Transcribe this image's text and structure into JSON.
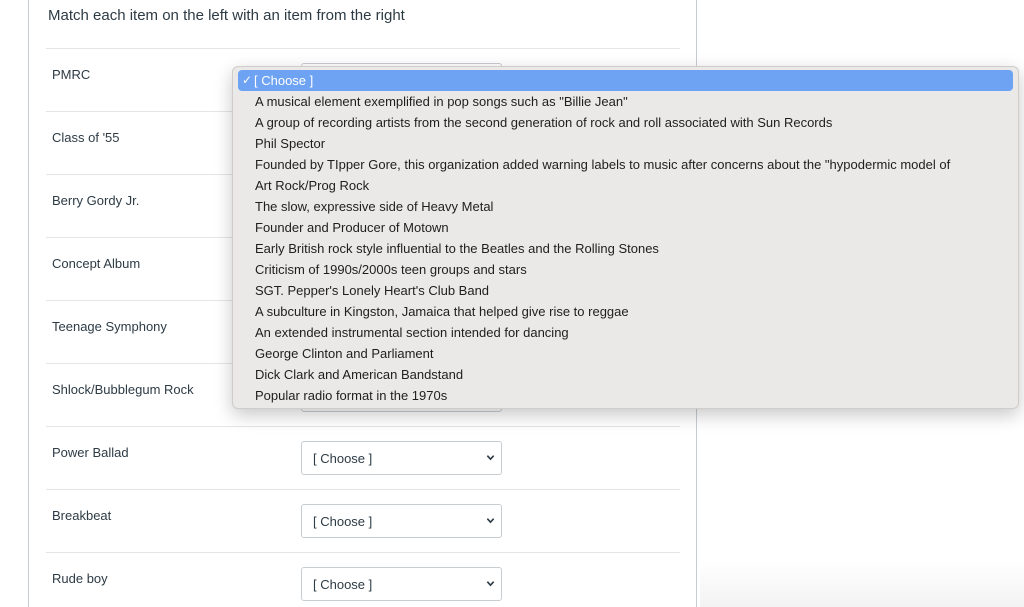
{
  "instructions": "Match each item on the left with an item from the right",
  "rows": [
    {
      "label": "PMRC",
      "value": "[ Choose ]"
    },
    {
      "label": "Class of '55",
      "value": "[ Choose ]"
    },
    {
      "label": "Berry Gordy Jr.",
      "value": "[ Choose ]"
    },
    {
      "label": "Concept Album",
      "value": "[ Choose ]"
    },
    {
      "label": "Teenage Symphony",
      "value": "[ Choose ]"
    },
    {
      "label": "Shlock/Bubblegum Rock",
      "value": "[ Choose ]"
    },
    {
      "label": "Power Ballad",
      "value": "[ Choose ]"
    },
    {
      "label": "Breakbeat",
      "value": "[ Choose ]"
    },
    {
      "label": "Rude boy",
      "value": "[ Choose ]"
    }
  ],
  "dropdown": {
    "check_glyph": "✓",
    "options": [
      "[ Choose ]",
      "A musical element exemplified in pop songs such as \"Billie Jean\"",
      "A group of recording artists from the second generation of rock and roll associated with Sun Records",
      "Phil Spector",
      "Founded by TIpper Gore, this organization added warning labels to music after concerns about the \"hypodermic model of",
      "Art Rock/Prog Rock",
      "The slow, expressive side of Heavy Metal",
      "Founder and Producer of Motown",
      "Early British rock style influential to the Beatles and the Rolling Stones",
      "Criticism of 1990s/2000s teen groups and stars",
      "SGT. Pepper's Lonely Heart's Club Band",
      "A subculture in Kingston, Jamaica that helped give rise to reggae",
      "An extended instrumental section intended for dancing",
      "George Clinton and Parliament",
      "Dick Clark and American Bandstand",
      "Popular radio format in the 1970s"
    ]
  },
  "colors": {
    "selected_option": "#6ea2f2",
    "dropdown_bg": "#ebe9e7",
    "text": "#2d3b45"
  },
  "icons": {
    "select_chevron": "chevron-down-icon",
    "selected_mark": "checkmark-icon"
  }
}
